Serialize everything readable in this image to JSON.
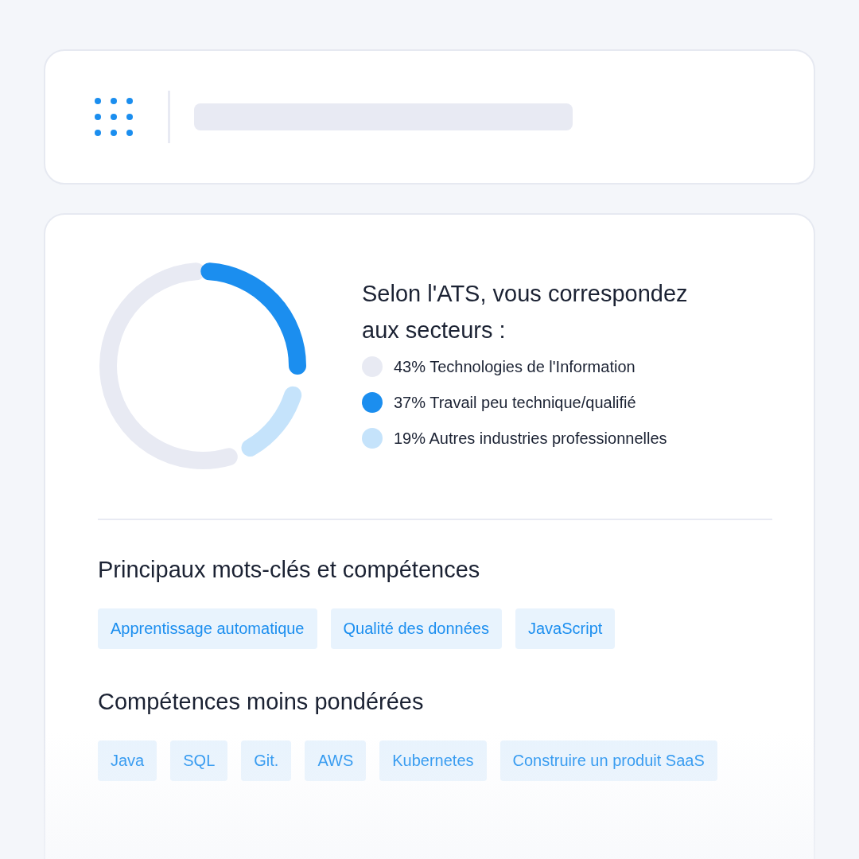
{
  "header": {
    "kind": "skeleton"
  },
  "sectors": {
    "title": "Selon l'ATS, vous correspondez aux secteurs :",
    "items": [
      {
        "label": "43% Technologies de l'Information",
        "color": "#e8eaf3"
      },
      {
        "label": "37% Travail peu technique/qualifié",
        "color": "#1b8eef"
      },
      {
        "label": "19% Autres industries professionnelles",
        "color": "#c5e3fb"
      }
    ]
  },
  "sections": [
    {
      "title": "Principaux mots-clés et compétences",
      "tags": [
        "Apprentissage automatique",
        "Qualité des données",
        "JavaScript"
      ]
    },
    {
      "title": "Compétences moins pondérées",
      "tags": [
        "Java",
        "SQL",
        "Git.",
        "AWS",
        "Kubernetes",
        "Construire un produit SaaS"
      ]
    }
  ]
}
